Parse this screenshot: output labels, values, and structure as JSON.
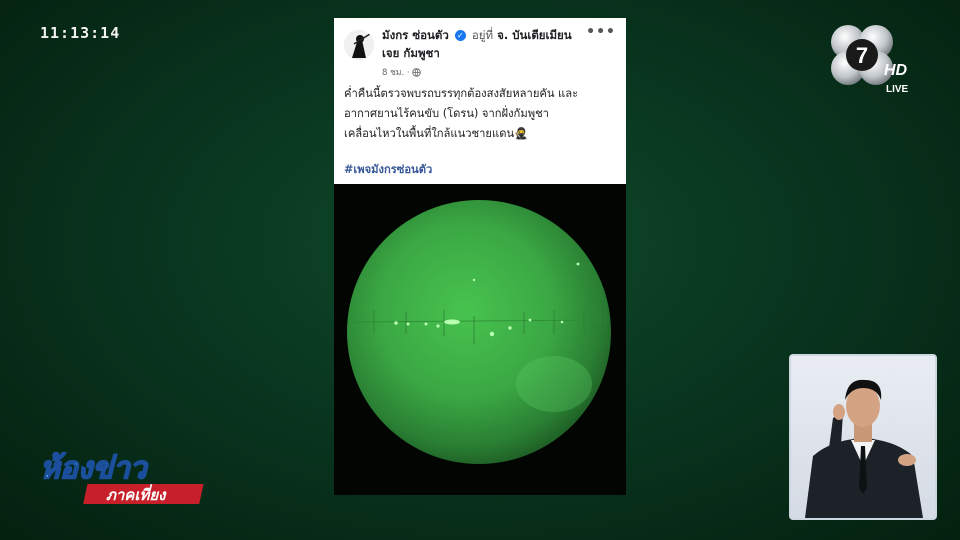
{
  "broadcast": {
    "clock": "11:13:14",
    "channel_number": "7",
    "hd_label": "HD",
    "live_label": "LIVE",
    "show_logo_line1": "ห้องข่าว",
    "show_logo_line2": "ภาคเที่ยง"
  },
  "post": {
    "page_name": "มังกร ซ่อนตัว",
    "at_word": "อยู่ที่",
    "location_line1": "จ. บันเตียเมียน",
    "location_line2": "เจย กัมพูชา",
    "timestamp": "8 ชม. ·",
    "more_icon": "more-dots-icon",
    "body_lines": [
      "ค่ำคืนนี้ตรวจพบรถบรรทุกต้องสงสัยหลายคัน และ",
      "อากาศยานไร้คนขับ (โดรน) จากฝั่งกัมพูชา",
      "เคลื่อนไหวในพื้นที่ใกล้แนวชายแดน🥷"
    ],
    "hashtag": "#เพจมังกรซ่อนตัว"
  },
  "colors": {
    "background": "#093620",
    "night_vision": "#3fbf4a",
    "hashtag": "#385898",
    "verified": "#1877f2"
  }
}
